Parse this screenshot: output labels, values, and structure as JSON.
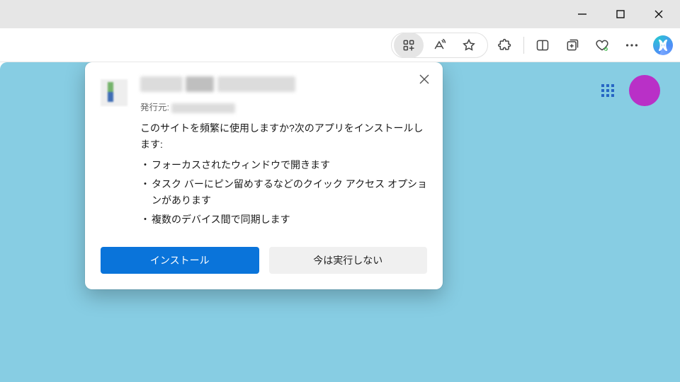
{
  "window": {
    "minimize_icon": "minimize",
    "maximize_icon": "maximize",
    "close_icon": "close"
  },
  "toolbar": {
    "app_install_icon": "app-grid-plus",
    "read_aloud_icon": "read-aloud",
    "favorite_icon": "star",
    "extensions_icon": "puzzle",
    "split_icon": "split-screen",
    "collections_icon": "collections",
    "performance_icon": "heartbeat",
    "overflow_icon": "more",
    "copilot_icon": "copilot"
  },
  "page": {
    "bg": "#87cde3",
    "apps_icon": "apps-grid",
    "avatar_color": "#b930c7"
  },
  "popup": {
    "close_icon": "close",
    "publisher_prefix": "発行元:",
    "desc": "このサイトを頻繁に使用しますか?次のアプリをインストールします:",
    "bullets": [
      "フォーカスされたウィンドウで開きます",
      "タスク バーにピン留めするなどのクイック アクセス オプションがあります",
      "複数のデバイス間で同期します"
    ],
    "install_label": "インストール",
    "not_now_label": "今は実行しない"
  }
}
